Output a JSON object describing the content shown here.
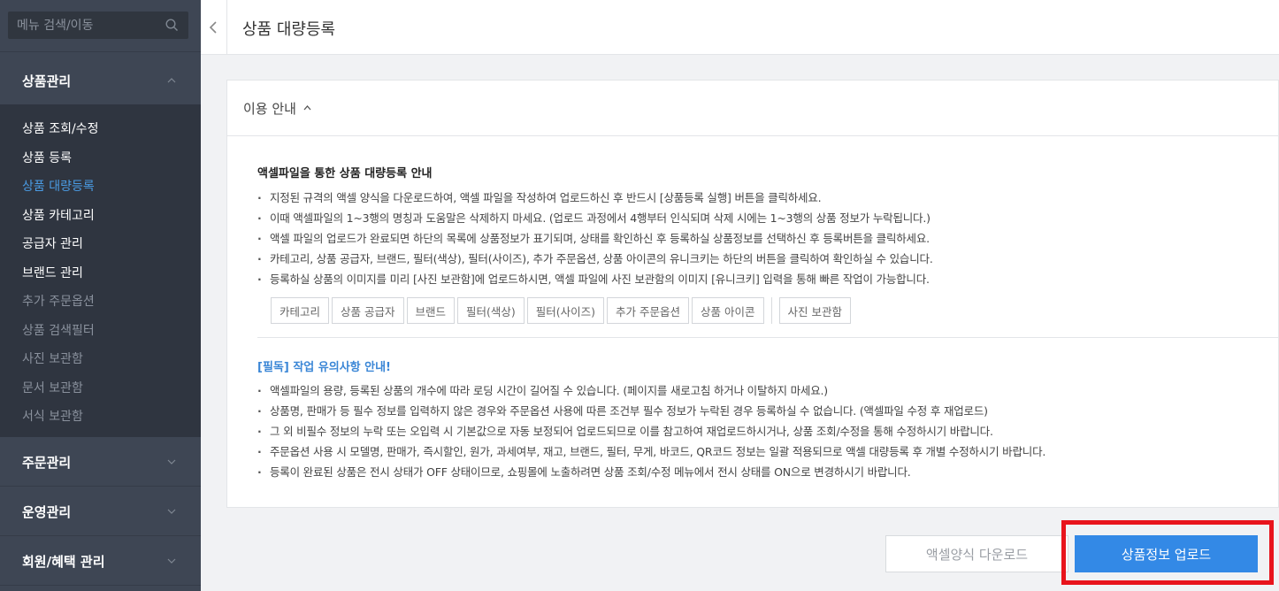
{
  "sidebar": {
    "search_placeholder": "메뉴 검색/이동",
    "sections": {
      "product": "상품관리",
      "order": "주문관리",
      "operation": "운영관리",
      "member": "회원/혜택 관리"
    },
    "items": [
      "상품 조회/수정",
      "상품 등록",
      "상품 대량등록",
      "상품 카테고리",
      "공급자 관리",
      "브랜드 관리",
      "추가 주문옵션",
      "상품 검색필터",
      "사진 보관함",
      "문서 보관함",
      "서식 보관함"
    ],
    "active_color": "#4a9be3"
  },
  "header": {
    "title": "상품 대량등록"
  },
  "guide": {
    "toggle_label": "이용 안내",
    "title": "액셀파일을 통한 상품 대량등록 안내",
    "bullets": [
      "지정된 규격의 액셀 양식을 다운로드하여, 액셀 파일을 작성하여 업로드하신 후 반드시 [상품등록 실행] 버튼을 클릭하세요.",
      "이때 액셀파일의 1~3행의 명칭과 도움말은 삭제하지 마세요. (업로드 과정에서 4행부터 인식되며 삭제 시에는 1~3행의 상품 정보가 누락됩니다.)",
      "액셀 파일의 업로드가 완료되면 하단의 목록에 상품정보가 표기되며, 상태를 확인하신 후 등록하실 상품정보를 선택하신 후 등록버튼을 클릭하세요.",
      "카테고리, 상품 공급자, 브랜드, 필터(색상), 필터(사이즈), 추가 주문옵션, 상품 아이콘의 유니크키는 하단의 버튼을 클릭하여 확인하실 수 있습니다.",
      "등록하실 상품의 이미지를 미리 [사진 보관함]에 업로드하시면, 액셀 파일에 사진 보관함의 이미지 [유니크키] 입력을 통해 빠른 작업이 가능합니다."
    ],
    "key_buttons": [
      "카테고리",
      "상품 공급자",
      "브랜드",
      "필터(색상)",
      "필터(사이즈)",
      "추가 주문옵션",
      "상품 아이콘"
    ],
    "photo_button": "사진 보관함"
  },
  "notice": {
    "title": "[필독] 작업 유의사항 안내!",
    "bullets": [
      "액셀파일의 용량, 등록된 상품의 개수에 따라 로딩 시간이 길어질 수 있습니다. (페이지를 새로고침 하거나 이탈하지 마세요.)",
      "상품명, 판매가 등 필수 정보를 입력하지 않은 경우와 주문옵션 사용에 따른 조건부 필수 정보가 누락된 경우 등록하실 수 없습니다. (액셀파일 수정 후 재업로드)",
      "그 외 비필수 정보의 누락 또는 오입력 시 기본값으로 자동 보정되어 업로드되므로 이를 참고하여 재업로드하시거나, 상품 조회/수정을 통해 수정하시기 바랍니다.",
      "주문옵션 사용 시 모델명, 판매가, 즉시할인, 원가, 과세여부, 재고, 브랜드, 필터, 무게, 바코드, QR코드 정보는 일괄 적용되므로 액셀 대량등록 후 개별 수정하시기 바랍니다.",
      "등록이 완료된 상품은 전시 상태가 OFF 상태이므로, 쇼핑몰에 노출하려면 상품 조회/수정 메뉴에서 전시 상태를 ON으로 변경하시기 바랍니다."
    ]
  },
  "actions": {
    "download_label": "액셀양식 다운로드",
    "upload_label": "상품정보 업로드",
    "upload_color": "#3389e6",
    "highlight_color": "#e8141c"
  }
}
